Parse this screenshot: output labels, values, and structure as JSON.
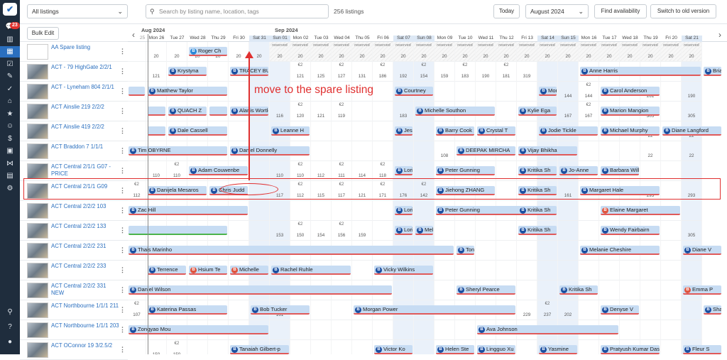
{
  "sidebar": {
    "badge": "23",
    "icons": [
      "logo-icon",
      "chat-icon",
      "chart-icon",
      "calendar-icon",
      "checklist-icon",
      "brush-icon",
      "check-icon",
      "home-icon",
      "star-icon",
      "users-icon",
      "dollar-icon",
      "briefcase-icon",
      "share-icon",
      "grid-icon",
      "gear-icon",
      "search-icon",
      "help-icon",
      "user-icon"
    ],
    "glyphs": [
      "✔",
      "💬",
      "▥",
      "▦",
      "☑",
      "✎",
      "✓",
      "⌂",
      "★",
      "☺",
      "$",
      "▣",
      "⋈",
      "▤",
      "⚙",
      "⚲",
      "?",
      "●"
    ]
  },
  "topbar": {
    "listing_filter": "All listings",
    "search_placeholder": "Search by listing name, location, tags",
    "listing_count": "256 listings",
    "today": "Today",
    "month": "August 2024",
    "find_availability": "Find availability",
    "switch_view": "Switch to old version"
  },
  "bulk_edit": "Bulk Edit",
  "header": {
    "month1": "Aug 2024",
    "month2": "Sep 2024",
    "days": [
      "25",
      "Mon 26",
      "Tue 27",
      "Wed 28",
      "Thu 29",
      "Fri 30",
      "Sat 31",
      "Sun 01",
      "Mon 02",
      "Tue 03",
      "Wed 04",
      "Thu 05",
      "Fri 06",
      "Sat 07",
      "Sun 08",
      "Mon 09",
      "Tue 10",
      "Wed 11",
      "Thu 12",
      "Fri 13",
      "Sat 14",
      "Sun 15",
      "Mon 16",
      "Tue 17",
      "Wed 18",
      "Thu 19",
      "Fri 20",
      "Sat 21"
    ]
  },
  "listings": [
    {
      "name": "AA Spare listing",
      "empty": true
    },
    {
      "name": "ACT - 79 HighGate 2/2/1"
    },
    {
      "name": "ACT - Lyneham 804 2/1/1"
    },
    {
      "name": "ACT Ainslie 219 2/2/2"
    },
    {
      "name": "ACT Ainslie 419 2/2/2"
    },
    {
      "name": "ACT Braddon 7 1/1/1"
    },
    {
      "name": "ACT Central 2/1/1 G07 - PRICE"
    },
    {
      "name": "ACT Central 2/1/1 G09"
    },
    {
      "name": "ACT Central 2/2/2 103"
    },
    {
      "name": "ACT Central 2/2/2 133"
    },
    {
      "name": "ACT Central 2/2/2 231"
    },
    {
      "name": "ACT Central 2/2/2 233"
    },
    {
      "name": "ACT Central 2/2/2 331 NEW"
    },
    {
      "name": "ACT Northbourne 1/1/1 211"
    },
    {
      "name": "ACT Northbourne 1/1/1 203"
    },
    {
      "name": "ACT OConnor 19 3/2.5/2"
    }
  ],
  "grid": {
    "prices": [
      [
        "",
        "20",
        "20",
        "20",
        "20",
        "20",
        "20",
        "20",
        "20",
        "20",
        "20",
        "20",
        "20",
        "20",
        "20",
        "20",
        "20",
        "20",
        "20",
        "20",
        "20",
        "20",
        "20",
        "20",
        "20",
        "20",
        "20",
        "20"
      ],
      [
        "",
        "121",
        "",
        "",
        "",
        "",
        "",
        "",
        "121",
        "125",
        "127",
        "131",
        "186",
        "192",
        "154",
        "159",
        "183",
        "190",
        "181",
        "319",
        "",
        "",
        "",
        "",
        "",
        "",
        "",
        ""
      ],
      [
        "",
        "",
        "",
        "",
        "",
        "",
        "",
        "",
        "",
        "",
        "",
        "",
        "",
        "",
        "",
        "",
        "",
        "",
        "",
        "",
        "",
        "144",
        "144",
        "",
        "",
        "261",
        "",
        "190"
      ],
      [
        "",
        "",
        "",
        "",
        "",
        "",
        "",
        "116",
        "120",
        "121",
        "119",
        "",
        "",
        "183",
        "",
        "",
        "",
        "",
        "",
        "",
        "",
        "167",
        "167",
        "",
        "",
        "305",
        "",
        "305"
      ],
      [
        "",
        "",
        "",
        "",
        "",
        "",
        "",
        "",
        "",
        "",
        "",
        "",
        "",
        "",
        "",
        "",
        "",
        "",
        "",
        "",
        "",
        "",
        "",
        "",
        "",
        "22",
        "",
        "22"
      ],
      [
        "",
        "",
        "",
        "",
        "",
        "",
        "",
        "",
        "",
        "",
        "",
        "",
        "",
        "",
        "",
        "108",
        "",
        "",
        "",
        "",
        "",
        "",
        "",
        "",
        "",
        "22",
        "",
        "22"
      ],
      [
        "",
        "110",
        "110",
        "",
        "",
        "",
        "",
        "110",
        "110",
        "112",
        "111",
        "114",
        "118",
        "",
        "",
        "",
        "",
        "",
        "",
        "",
        "",
        "",
        "",
        "",
        "",
        "",
        "",
        ""
      ],
      [
        "112",
        "",
        "",
        "",
        "",
        "",
        "",
        "117",
        "112",
        "115",
        "117",
        "121",
        "171",
        "176",
        "142",
        "",
        "",
        "",
        "",
        "",
        "",
        "161",
        "",
        "",
        "",
        "293",
        "",
        "293"
      ],
      [
        "",
        "",
        "",
        "",
        "",
        "",
        "",
        "",
        "",
        "",
        "",
        "",
        "",
        "",
        "",
        "",
        "",
        "",
        "",
        "",
        "",
        "",
        "",
        "",
        "",
        "",
        "",
        ""
      ],
      [
        "",
        "",
        "",
        "",
        "",
        "",
        "",
        "153",
        "150",
        "154",
        "156",
        "159",
        "",
        "",
        "",
        "",
        "",
        "",
        "",
        "",
        "",
        "",
        "",
        "",
        "",
        "",
        "",
        "305"
      ],
      [
        "",
        "",
        "",
        "",
        "",
        "",
        "",
        "",
        "",
        "",
        "",
        "",
        "",
        "",
        "",
        "",
        "",
        "",
        "",
        "",
        "",
        "",
        "",
        "",
        "",
        "",
        "",
        ""
      ],
      [
        "",
        "",
        "",
        "",
        "",
        "",
        "",
        "",
        "",
        "",
        "",
        "",
        "",
        "",
        "",
        "",
        "",
        "",
        "",
        "",
        "",
        "",
        "",
        "",
        "",
        "",
        "",
        ""
      ],
      [
        "",
        "",
        "",
        "",
        "",
        "",
        "",
        "",
        "",
        "",
        "",
        "",
        "",
        "",
        "",
        "",
        "",
        "",
        "",
        "",
        "",
        "",
        "",
        "",
        "",
        "",
        "",
        ""
      ],
      [
        "107",
        "",
        "",
        "",
        "",
        "",
        "",
        "161",
        "",
        "",
        "",
        "",
        "",
        "",
        "",
        "",
        "",
        "",
        "",
        "229",
        "237",
        "202",
        "",
        "",
        "",
        "",
        "",
        ""
      ],
      [
        "",
        "",
        "",
        "",
        "",
        "",
        "",
        "",
        "",
        "",
        "",
        "",
        "",
        "",
        "",
        "",
        "",
        "",
        "",
        "",
        "",
        "",
        "",
        "",
        "",
        "",
        "",
        ""
      ],
      [
        "",
        "150",
        "150",
        "",
        "",
        "",
        "",
        "",
        "",
        "",
        "",
        "",
        "",
        "",
        "",
        "",
        "",
        "",
        "",
        "",
        "",
        "",
        "",
        "",
        "",
        "",
        "",
        ""
      ]
    ],
    "bookings": [
      [
        0,
        3,
        5,
        "Roger Ch",
        "blue2",
        false
      ],
      [
        1,
        2,
        4,
        "Krystyna",
        "",
        false
      ],
      [
        1,
        5,
        7,
        "TRACEY BUGGY",
        "",
        false
      ],
      [
        1,
        22,
        28,
        "Anne Harris",
        "",
        false
      ],
      [
        1,
        28,
        29,
        "Brian H",
        "",
        false
      ],
      [
        2,
        0,
        1,
        "",
        "",
        false
      ],
      [
        2,
        1,
        5,
        "Matthew Taylor",
        "",
        false
      ],
      [
        2,
        13,
        15,
        "Courtney",
        "",
        false
      ],
      [
        2,
        20,
        21,
        "Monique",
        "",
        false
      ],
      [
        2,
        23,
        26,
        "Carol Anderson",
        "",
        false
      ],
      [
        3,
        1,
        2,
        "",
        "red",
        false
      ],
      [
        3,
        2,
        4,
        "QUACH Z",
        "",
        false
      ],
      [
        3,
        4,
        5,
        "",
        "",
        false
      ],
      [
        3,
        5,
        7,
        "Alanis Wortley",
        "",
        false
      ],
      [
        3,
        14,
        18,
        "Michelle Southon",
        "",
        false
      ],
      [
        3,
        19,
        21,
        "Kylie Ega",
        "",
        false
      ],
      [
        3,
        23,
        26,
        "Marion Mangion",
        "",
        false
      ],
      [
        4,
        1,
        2,
        "",
        "",
        false
      ],
      [
        4,
        2,
        5,
        "Dale Cassell",
        "",
        false
      ],
      [
        4,
        7,
        9,
        "Leanne H",
        "",
        false
      ],
      [
        4,
        13,
        14,
        "Jessica C",
        "",
        false
      ],
      [
        4,
        15,
        17,
        "Barry Cook",
        "",
        false
      ],
      [
        4,
        17,
        19,
        "Crystal T",
        "",
        false
      ],
      [
        4,
        20,
        23,
        "Jodie Tickle",
        "",
        false
      ],
      [
        4,
        23,
        26,
        "Michael Murphy",
        "",
        false
      ],
      [
        4,
        26,
        29,
        "Diane Langford",
        "",
        false
      ],
      [
        5,
        0,
        5,
        "Tim OBYRNE",
        "",
        false
      ],
      [
        5,
        5,
        9,
        "Daniel Donnelly",
        "",
        false
      ],
      [
        5,
        16,
        19,
        "DEEPAK MIRCHA",
        "",
        false
      ],
      [
        5,
        19,
        22,
        "Vijay Bhikha",
        "",
        false
      ],
      [
        6,
        3,
        6,
        "Adam Couwenbe",
        "",
        false
      ],
      [
        6,
        13,
        14,
        "Lori Herri",
        "",
        false
      ],
      [
        6,
        15,
        18,
        "Peter Gunning",
        "",
        false
      ],
      [
        6,
        19,
        21,
        "Kritika Sh",
        "",
        false
      ],
      [
        6,
        21,
        23,
        "Jo-Anne",
        "",
        false
      ],
      [
        6,
        23,
        25,
        "Barbara Wills",
        "",
        false
      ],
      [
        7,
        1,
        4,
        "Danijela Mesaros",
        "",
        false
      ],
      [
        7,
        4,
        6,
        "Chris Judd",
        "",
        false
      ],
      [
        7,
        15,
        18,
        "Jiehong ZHANG",
        "",
        false
      ],
      [
        7,
        19,
        21,
        "Kritika Sh",
        "",
        false
      ],
      [
        7,
        22,
        26,
        "Margaret Hale",
        "",
        false
      ],
      [
        8,
        0,
        6,
        "Zac Hill",
        "",
        false
      ],
      [
        8,
        13,
        14,
        "Lori Herri",
        "",
        false
      ],
      [
        8,
        15,
        20,
        "Peter Gunning",
        "",
        false
      ],
      [
        8,
        19,
        21,
        "Kritika Sh",
        "",
        false
      ],
      [
        8,
        23,
        27,
        "Elaine Margaret",
        "red",
        false
      ],
      [
        9,
        0,
        5,
        "",
        "",
        true
      ],
      [
        9,
        13,
        14,
        "Lori Herri",
        "",
        false
      ],
      [
        9,
        14,
        15,
        "Melanie I",
        "",
        false
      ],
      [
        9,
        19,
        21,
        "Kritika Sh",
        "",
        false
      ],
      [
        9,
        23,
        26,
        "Wendy Fairbairn",
        "",
        false
      ],
      [
        10,
        0,
        16,
        "Thais Marinho",
        "",
        false
      ],
      [
        10,
        16,
        17,
        "Tony Mah",
        "",
        false
      ],
      [
        10,
        22,
        26,
        "Melanie Cheshire",
        "",
        false
      ],
      [
        10,
        27,
        29,
        "Diane V",
        "",
        false
      ],
      [
        11,
        1,
        3,
        "Terrence",
        "",
        false
      ],
      [
        11,
        3,
        5,
        "Hsium Te",
        "red",
        false
      ],
      [
        11,
        5,
        7,
        "Michelle",
        "red",
        false
      ],
      [
        11,
        7,
        11,
        "Rachel Ruhle",
        "",
        false
      ],
      [
        11,
        12,
        15,
        "Vicky Wilkins",
        "",
        false
      ],
      [
        12,
        0,
        13,
        "Daniel Wilson",
        "",
        false
      ],
      [
        12,
        16,
        19,
        "Sheryl Pearce",
        "",
        false
      ],
      [
        12,
        21,
        23,
        "Kritika Sh",
        "",
        false
      ],
      [
        12,
        27,
        29,
        "Emma P",
        "red",
        false
      ],
      [
        13,
        1,
        5,
        "Katerina Passas",
        "",
        false
      ],
      [
        13,
        6,
        9,
        "Bob Tucker",
        "",
        false
      ],
      [
        13,
        11,
        19,
        "Morgan Power",
        "",
        false
      ],
      [
        13,
        23,
        25,
        "Denyse V",
        "",
        false
      ],
      [
        13,
        28,
        29,
        "Sharryn",
        "",
        false
      ],
      [
        14,
        0,
        7,
        "Zongyao Mou",
        "",
        false
      ],
      [
        14,
        17,
        24,
        "Ava Johnson",
        "",
        false
      ],
      [
        15,
        5,
        8,
        "Tanaiah Gilbert-p",
        "",
        false
      ],
      [
        15,
        12,
        14,
        "Victor Ko",
        "",
        false
      ],
      [
        15,
        15,
        17,
        "Helen Ste",
        "",
        false
      ],
      [
        15,
        17,
        19,
        "Lingguo Xu",
        "",
        false
      ],
      [
        15,
        20,
        22,
        "Yasmine",
        "",
        false
      ],
      [
        15,
        23,
        26,
        "Pratyush Kumar Das",
        "",
        false
      ],
      [
        15,
        27,
        29,
        "Fleur S",
        "",
        false
      ]
    ]
  },
  "annotation": "move to the spare listing",
  "colors": {
    "accent": "#2a6fbf",
    "annotation": "#e03030",
    "bar": "#c7dcf3"
  }
}
